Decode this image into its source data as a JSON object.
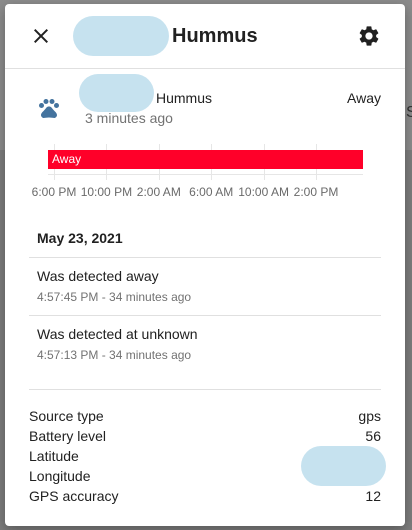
{
  "dialog": {
    "title": "Hummus"
  },
  "entity": {
    "name": "Hummus",
    "state": "Away",
    "last_changed": "3 minutes ago",
    "icon": "paw-icon",
    "icon_color": "#44739e"
  },
  "timeline": {
    "state_label": "Away",
    "color": "#ff0029",
    "state_fraction": 1.0,
    "ticks": [
      "6:00 PM",
      "10:00 PM",
      "2:00 AM",
      "6:00 AM",
      "10:00 AM",
      "2:00 PM"
    ]
  },
  "logbook": {
    "date": "May 23, 2021",
    "entries": [
      {
        "message": "Was detected away",
        "time": "4:57:45 PM - 34 minutes ago"
      },
      {
        "message": "Was detected at unknown",
        "time": "4:57:13 PM - 34 minutes ago"
      }
    ]
  },
  "attributes": [
    {
      "label": "Source type",
      "value": "gps"
    },
    {
      "label": "Battery level",
      "value": "56"
    },
    {
      "label": "Latitude",
      "value": ""
    },
    {
      "label": "Longitude",
      "value": ""
    },
    {
      "label": "GPS accuracy",
      "value": "12"
    }
  ]
}
